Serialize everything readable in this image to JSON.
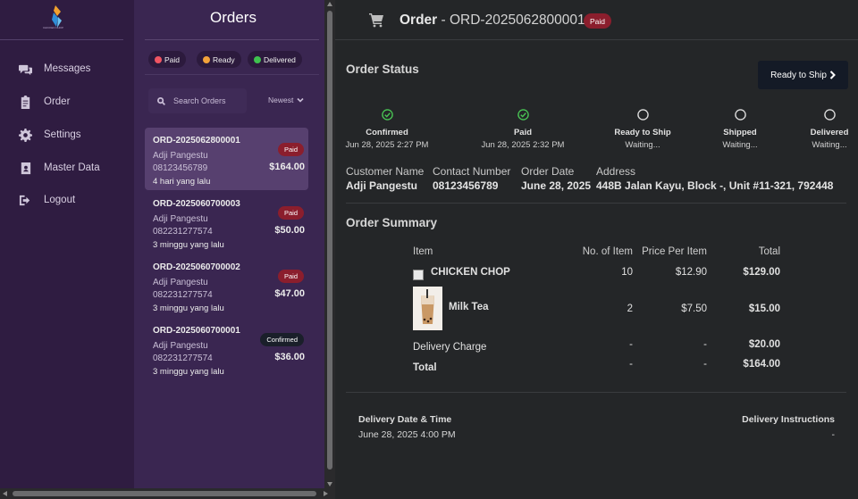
{
  "sidebar": {
    "logo_text": "CHICKEN CHOP",
    "items": [
      {
        "label": "Messages",
        "icon": "messages-icon"
      },
      {
        "label": "Order",
        "icon": "clipboard-icon"
      },
      {
        "label": "Settings",
        "icon": "gear-icon"
      },
      {
        "label": "Master Data",
        "icon": "address-book-icon"
      },
      {
        "label": "Logout",
        "icon": "logout-icon"
      }
    ]
  },
  "orders": {
    "title": "Orders",
    "filters": [
      {
        "label": "Paid",
        "color": "#f05563"
      },
      {
        "label": "Ready",
        "color": "#f2a23a"
      },
      {
        "label": "Delivered",
        "color": "#3fc24f"
      }
    ],
    "search_placeholder": "Search Orders",
    "sort_label": "Newest",
    "list": [
      {
        "id": "ORD-2025062800001",
        "name": "Adji Pangestu",
        "phone": "08123456789",
        "time": "4 hari yang lalu",
        "status": "Paid",
        "amount": "$164.00"
      },
      {
        "id": "ORD-2025060700003",
        "name": "Adji Pangestu",
        "phone": "082231277574",
        "time": "3 minggu yang lalu",
        "status": "Paid",
        "amount": "$50.00"
      },
      {
        "id": "ORD-2025060700002",
        "name": "Adji Pangestu",
        "phone": "082231277574",
        "time": "3 minggu yang lalu",
        "status": "Paid",
        "amount": "$47.00"
      },
      {
        "id": "ORD-2025060700001",
        "name": "Adji Pangestu",
        "phone": "082231277574",
        "time": "3 minggu yang lalu",
        "status": "Confirmed",
        "amount": "$36.00"
      }
    ]
  },
  "header": {
    "title_bold": "Order",
    "title_rest": " - ORD-2025062800001",
    "badge": "Paid"
  },
  "status": {
    "title": "Order Status",
    "action_label": "Ready to Ship",
    "steps": [
      {
        "label": "Confirmed",
        "time": "Jun 28, 2025 2:27 PM",
        "done": true
      },
      {
        "label": "Paid",
        "time": "Jun 28, 2025 2:32 PM",
        "done": true
      },
      {
        "label": "Ready to Ship",
        "time": "Waiting...",
        "done": false
      },
      {
        "label": "Shipped",
        "time": "Waiting...",
        "done": false
      },
      {
        "label": "Delivered",
        "time": "Waiting...",
        "done": false
      }
    ]
  },
  "customer": {
    "name_label": "Customer Name",
    "name": "Adji Pangestu",
    "contact_label": "Contact Number",
    "contact": "08123456789",
    "date_label": "Order Date",
    "date": "June 28, 2025",
    "address_label": "Address",
    "address": "448B Jalan Kayu, Block -, Unit #11-321, 792448"
  },
  "summary": {
    "title": "Order Summary",
    "headers": {
      "item": "Item",
      "qty": "No. of Item",
      "price": "Price Per Item",
      "total": "Total"
    },
    "items": [
      {
        "name": "CHICKEN CHOP",
        "qty": "10",
        "price": "$12.90",
        "total": "$129.00"
      },
      {
        "name": "Milk Tea",
        "qty": "2",
        "price": "$7.50",
        "total": "$15.00"
      }
    ],
    "delivery": {
      "label": "Delivery Charge",
      "qty": "-",
      "price": "-",
      "total": "$20.00"
    },
    "grand": {
      "label": "Total",
      "qty": "-",
      "price": "-",
      "total": "$164.00"
    }
  },
  "delivery": {
    "datetime_label": "Delivery Date & Time",
    "datetime": "June 28, 2025 4:00 PM",
    "instructions_label": "Delivery Instructions",
    "instructions": "-"
  },
  "colors": {
    "sidebar_bg": "#2f1c41",
    "orders_bg": "#3a2651",
    "main_bg": "#242628",
    "paid_badge": "#8b1e2d",
    "check_green": "#49c454"
  }
}
